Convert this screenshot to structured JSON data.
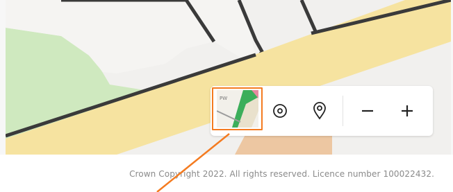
{
  "map": {
    "colors": {
      "background": "#f1f0ee",
      "road": "#f6e3a0",
      "road_outline": "#3a3a3a",
      "green": "#cfe9bf",
      "terracotta": "#edc7a2"
    }
  },
  "controls": {
    "layer_button": {
      "icon": "map-layers-thumbnail-icon",
      "highlight_color": "#f47b20"
    },
    "locate_button": {
      "icon": "locate-target-icon"
    },
    "marker_button": {
      "icon": "location-pin-icon"
    },
    "zoom_out_button": {
      "icon": "minus-icon"
    },
    "zoom_in_button": {
      "icon": "plus-icon"
    }
  },
  "footer": {
    "copyright": "Crown Copyright 2022. All rights reserved. Licence number 100022432."
  },
  "annotation": {
    "arrow_color": "#f47b20"
  }
}
